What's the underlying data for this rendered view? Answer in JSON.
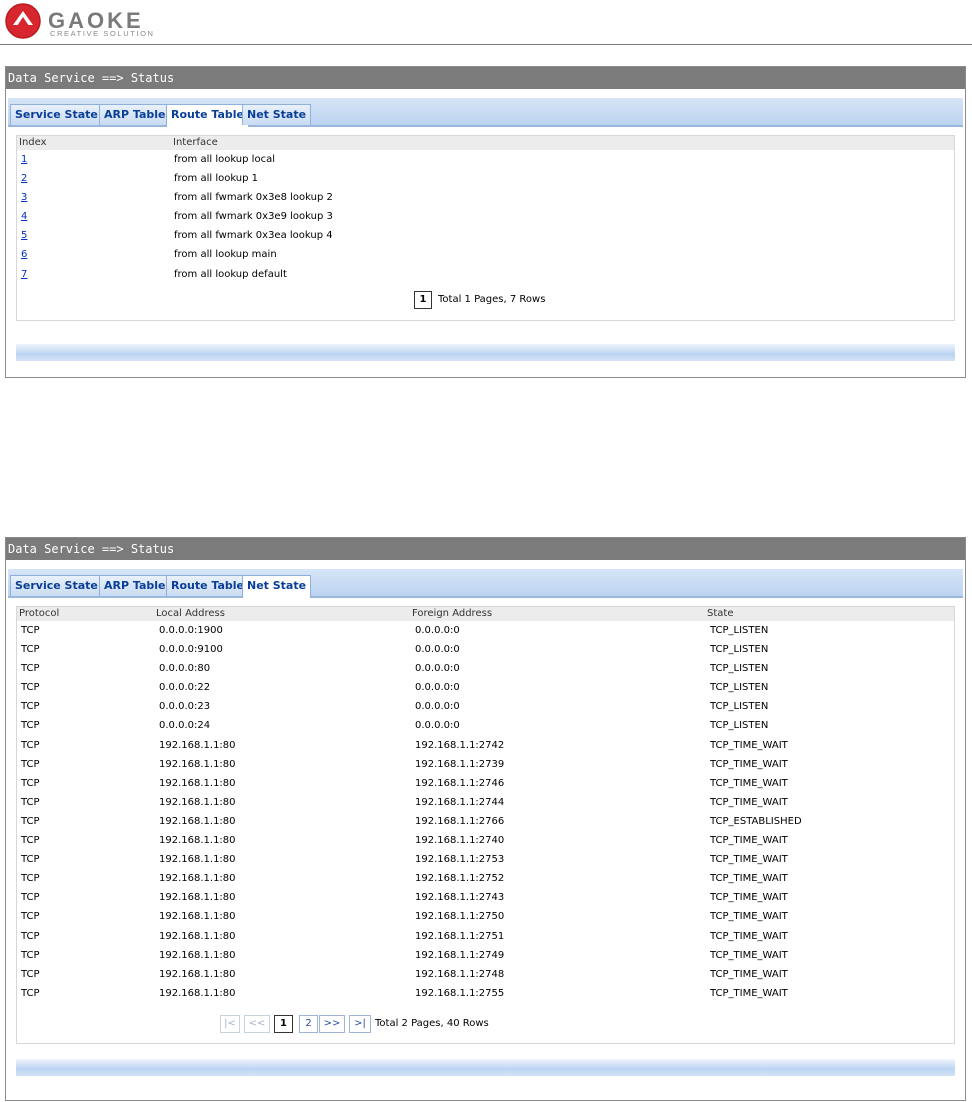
{
  "brand": {
    "name": "GAOKE",
    "tagline": "CREATIVE SOLUTION"
  },
  "panels": [
    {
      "title": "Data Service ==> Status",
      "tabs": [
        "Service State",
        "ARP Table",
        "Route Table",
        "Net State"
      ],
      "active_tab": "Route Table",
      "columns": [
        "Index",
        "Interface"
      ],
      "rows": [
        {
          "index": "1",
          "interface": "from all lookup local"
        },
        {
          "index": "2",
          "interface": "from all lookup 1"
        },
        {
          "index": "3",
          "interface": "from all fwmark 0x3e8 lookup 2"
        },
        {
          "index": "4",
          "interface": "from all fwmark 0x3e9 lookup 3"
        },
        {
          "index": "5",
          "interface": "from all fwmark 0x3ea lookup 4"
        },
        {
          "index": "6",
          "interface": "from all lookup main"
        },
        {
          "index": "7",
          "interface": "from all lookup default"
        }
      ],
      "pager": {
        "current": "1",
        "summary": "Total 1 Pages, 7 Rows"
      }
    },
    {
      "title": "Data Service ==> Status",
      "tabs": [
        "Service State",
        "ARP Table",
        "Route Table",
        "Net State"
      ],
      "active_tab": "Net State",
      "columns": [
        "Protocol",
        "Local Address",
        "Foreign Address",
        "State"
      ],
      "rows": [
        [
          "TCP",
          "0.0.0.0:1900",
          "0.0.0.0:0",
          "TCP_LISTEN"
        ],
        [
          "TCP",
          "0.0.0.0:9100",
          "0.0.0.0:0",
          "TCP_LISTEN"
        ],
        [
          "TCP",
          "0.0.0.0:80",
          "0.0.0.0:0",
          "TCP_LISTEN"
        ],
        [
          "TCP",
          "0.0.0.0:22",
          "0.0.0.0:0",
          "TCP_LISTEN"
        ],
        [
          "TCP",
          "0.0.0.0:23",
          "0.0.0.0:0",
          "TCP_LISTEN"
        ],
        [
          "TCP",
          "0.0.0.0:24",
          "0.0.0.0:0",
          "TCP_LISTEN"
        ],
        [
          "TCP",
          "192.168.1.1:80",
          "192.168.1.1:2742",
          "TCP_TIME_WAIT"
        ],
        [
          "TCP",
          "192.168.1.1:80",
          "192.168.1.1:2739",
          "TCP_TIME_WAIT"
        ],
        [
          "TCP",
          "192.168.1.1:80",
          "192.168.1.1:2746",
          "TCP_TIME_WAIT"
        ],
        [
          "TCP",
          "192.168.1.1:80",
          "192.168.1.1:2744",
          "TCP_TIME_WAIT"
        ],
        [
          "TCP",
          "192.168.1.1:80",
          "192.168.1.1:2766",
          "TCP_ESTABLISHED"
        ],
        [
          "TCP",
          "192.168.1.1:80",
          "192.168.1.1:2740",
          "TCP_TIME_WAIT"
        ],
        [
          "TCP",
          "192.168.1.1:80",
          "192.168.1.1:2753",
          "TCP_TIME_WAIT"
        ],
        [
          "TCP",
          "192.168.1.1:80",
          "192.168.1.1:2752",
          "TCP_TIME_WAIT"
        ],
        [
          "TCP",
          "192.168.1.1:80",
          "192.168.1.1:2743",
          "TCP_TIME_WAIT"
        ],
        [
          "TCP",
          "192.168.1.1:80",
          "192.168.1.1:2750",
          "TCP_TIME_WAIT"
        ],
        [
          "TCP",
          "192.168.1.1:80",
          "192.168.1.1:2751",
          "TCP_TIME_WAIT"
        ],
        [
          "TCP",
          "192.168.1.1:80",
          "192.168.1.1:2749",
          "TCP_TIME_WAIT"
        ],
        [
          "TCP",
          "192.168.1.1:80",
          "192.168.1.1:2748",
          "TCP_TIME_WAIT"
        ],
        [
          "TCP",
          "192.168.1.1:80",
          "192.168.1.1:2755",
          "TCP_TIME_WAIT"
        ]
      ],
      "pager": {
        "buttons": [
          "|<",
          "<<",
          "1",
          "2",
          ">>",
          ">|"
        ],
        "current": "1",
        "summary": "Total 2 Pages, 40 Rows"
      }
    }
  ],
  "colors": {
    "title_bar": "#7b7b7b",
    "tab_text": "#0a3f99",
    "link": "#0030c0",
    "logo_red": "#d8262e"
  }
}
